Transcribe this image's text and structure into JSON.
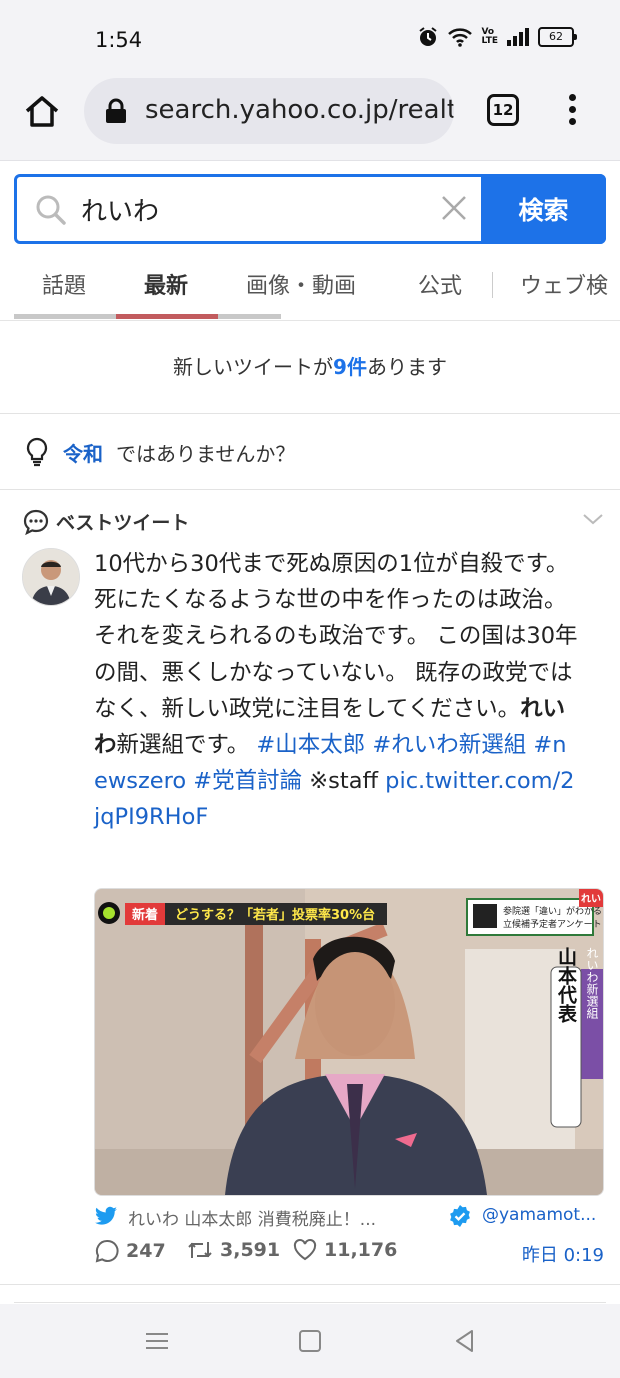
{
  "status": {
    "time": "1:54",
    "battery": "62",
    "volte": "Vo\nLTE"
  },
  "browser": {
    "url": "search.yahoo.co.jp/realt",
    "tab_count": "12"
  },
  "search": {
    "value": "れいわ",
    "button": "検索"
  },
  "tabs": [
    {
      "label": "話題"
    },
    {
      "label": "最新"
    },
    {
      "label": "画像・動画"
    },
    {
      "label": "公式"
    },
    {
      "label": "ウェブ検"
    }
  ],
  "new_tweets": {
    "before": "新しいツイートが",
    "count": "9件",
    "after": "あります"
  },
  "suggestion": {
    "term": "令和",
    "rest": "ではありませんか？"
  },
  "best": {
    "title": "ベストツイート"
  },
  "tweet": {
    "text1": "10代から30代まで死ぬ原因の1位が自殺です。死にたくなるような世の中を作ったのは政治。それを変えられるのも政治です。 この国は30年の間、悪くしかなっていない。 既存の政党ではなく、新しい政党に注目をしてください。",
    "bold": "れいわ",
    "text2": "新選組です。 ",
    "tags": "#山本太郎 #れいわ新選組 #newszero #党首討論",
    "staff": " ※staff ",
    "link": "pic.twitter.com/2jqPI9RHoF",
    "source_title": "れいわ 山本太郎 消費税廃止！...",
    "handle": "@yamamot...",
    "replies": "247",
    "retweets": "3,591",
    "likes": "11,176",
    "time": "昨日 0:19"
  },
  "media": {
    "badge_new": "新着",
    "headline": "どうする？「若者」投票率30%台",
    "qr_text1": "参院選「違い」がわかる",
    "qr_text2": "立候補予定者アンケート",
    "name_plate": "山本代表",
    "party_plate": "れいわ新選組",
    "corner": "れい"
  },
  "colors": {
    "accent": "#1d72e8",
    "link": "#1a62c8",
    "tab_active": "#c25b5e"
  }
}
